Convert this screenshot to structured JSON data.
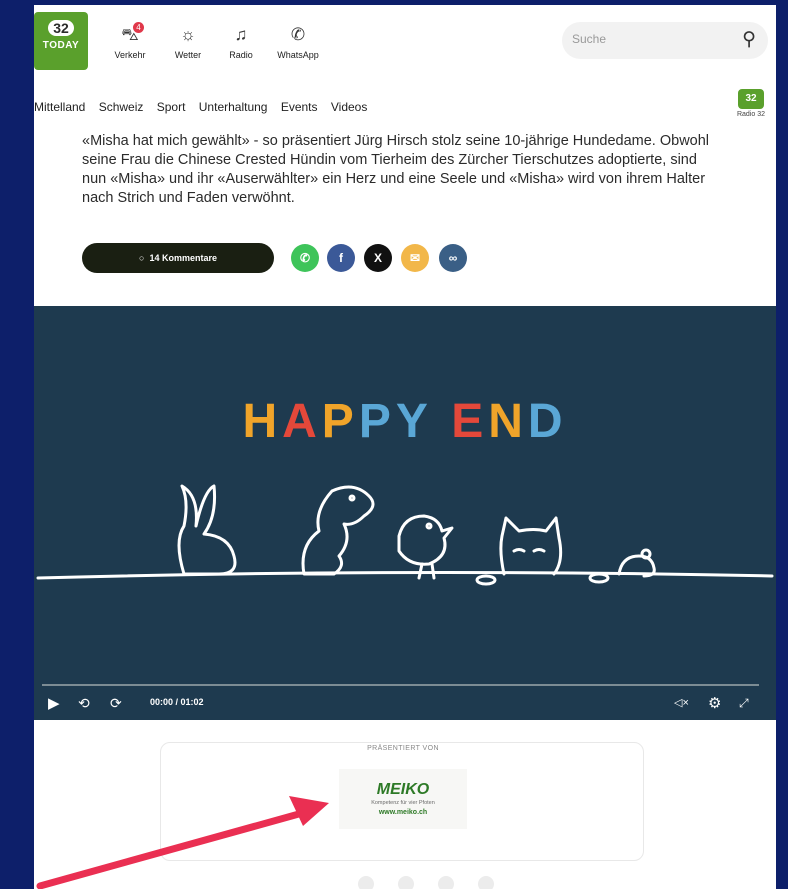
{
  "header": {
    "logo_number": "32",
    "logo_text": "TODAY",
    "nav": [
      {
        "label": "Verkehr",
        "icon": "car-icon",
        "badge": "4"
      },
      {
        "label": "Wetter",
        "icon": "sun-cloud-icon"
      },
      {
        "label": "Radio",
        "icon": "music-note-icon"
      },
      {
        "label": "WhatsApp",
        "icon": "whatsapp-icon"
      }
    ],
    "search_placeholder": "Suche"
  },
  "category_nav": [
    "Mittelland",
    "Schweiz",
    "Sport",
    "Unterhaltung",
    "Events",
    "Videos"
  ],
  "radio_badge": {
    "number": "32",
    "label": "Radio 32"
  },
  "article": {
    "text": "«Misha hat mich gewählt» - so präsentiert Jürg Hirsch stolz seine 10-jährige Hundedame. Obwohl seine Frau die Chinese Crested Hündin vom Tierheim des Zürcher Tierschutzes adoptierte, sind nun «Misha» und ihr «Auserwählter» ein Herz und eine Seele und «Misha» wird von ihrem Halter nach Strich und Faden verwöhnt.",
    "comments_label": "14 Kommentare",
    "share": [
      {
        "name": "whatsapp-share-button",
        "color": "#3ec45a",
        "glyph": "✆"
      },
      {
        "name": "facebook-share-button",
        "color": "#3b5998",
        "glyph": "f"
      },
      {
        "name": "x-share-button",
        "color": "#111111",
        "glyph": "X"
      },
      {
        "name": "email-share-button",
        "color": "#f2b749",
        "glyph": "✉"
      },
      {
        "name": "copy-link-button",
        "color": "#3a5f86",
        "glyph": "∞"
      }
    ]
  },
  "video": {
    "title_letters": [
      {
        "ch": "H",
        "color": "#f0a42a"
      },
      {
        "ch": "A",
        "color": "#e4483a"
      },
      {
        "ch": "P",
        "color": "#f0a42a"
      },
      {
        "ch": "P",
        "color": "#5aa7d6"
      },
      {
        "ch": "Y",
        "color": "#5aa7d6"
      },
      {
        "ch": " ",
        "color": "#ffffff"
      },
      {
        "ch": "E",
        "color": "#e4483a"
      },
      {
        "ch": "N",
        "color": "#f0a42a"
      },
      {
        "ch": "D",
        "color": "#5aa7d6"
      }
    ],
    "time": "00:00 / 01:02",
    "mute_label": "◁×"
  },
  "sponsor": {
    "label": "PRÄSENTIERT VON",
    "brand": "MEIKO",
    "tagline": "Kompetenz für vier Pfoten",
    "url": "www.meiko.ch"
  }
}
